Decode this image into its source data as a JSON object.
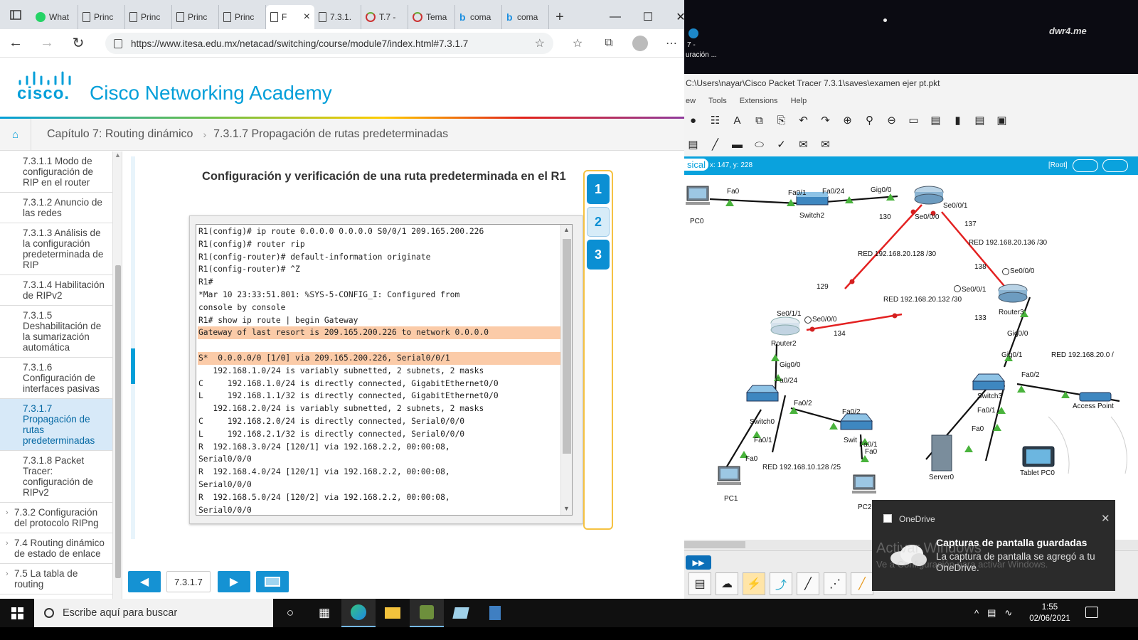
{
  "browser": {
    "tabs": [
      {
        "label": "What",
        "icon": "whatsapp-icon"
      },
      {
        "label": "Princ",
        "icon": "page-icon"
      },
      {
        "label": "Princ",
        "icon": "page-icon"
      },
      {
        "label": "Princ",
        "icon": "page-icon"
      },
      {
        "label": "Princ",
        "icon": "page-icon"
      },
      {
        "label": "F",
        "icon": "page-icon",
        "active": true
      },
      {
        "label": "7.3.1.",
        "icon": "page-icon"
      },
      {
        "label": "T.7 -",
        "icon": "site-icon"
      },
      {
        "label": "Tema",
        "icon": "site-icon"
      },
      {
        "label": "coma",
        "icon": "bing-icon"
      },
      {
        "label": "coma",
        "icon": "bing-icon"
      }
    ],
    "url": "https://www.itesa.edu.mx/netacad/switching/course/module7/index.html#7.3.1.7"
  },
  "header": {
    "logo_text": "cisco.",
    "academy_title": "Cisco Networking Academy",
    "chapter": "Capítulo 7: Routing dinámico",
    "page": "7.3.1.7 Propagación de rutas predeterminadas"
  },
  "sidebar": {
    "items": [
      {
        "label": "7.3.1.1 Modo de configuración de RIP en el router"
      },
      {
        "label": "7.3.1.2 Anuncio de las redes"
      },
      {
        "label": "7.3.1.3 Análisis de la configuración predeterminada de RIP"
      },
      {
        "label": "7.3.1.4 Habilitación de RIPv2"
      },
      {
        "label": "7.3.1.5 Deshabilitación de la sumarización automática"
      },
      {
        "label": "7.3.1.6 Configuración de interfaces pasivas"
      },
      {
        "label": "7.3.1.7 Propagación de rutas predeterminadas",
        "active": true
      },
      {
        "label": "7.3.1.8 Packet Tracer: configuración de RIPv2"
      }
    ],
    "sections": [
      {
        "label": "7.3.2 Configuración del protocolo RIPng"
      },
      {
        "label": "7.4 Routing dinámico de estado de enlace"
      },
      {
        "label": "7.5 La tabla de routing"
      },
      {
        "label": "7.6 Resumen"
      }
    ]
  },
  "content": {
    "title": "Configuración y verificación de una ruta predeterminada en el R1",
    "terminal_lines": [
      {
        "text": "R1(config)# ip route 0.0.0.0 0.0.0.0 S0/0/1 209.165.200.226",
        "hl": false
      },
      {
        "text": "R1(config)# router rip",
        "hl": false
      },
      {
        "text": "R1(config-router)# default-information originate",
        "hl": false
      },
      {
        "text": "R1(config-router)# ^Z",
        "hl": false
      },
      {
        "text": "R1#",
        "hl": false
      },
      {
        "text": "*Mar 10 23:33:51.801: %SYS-5-CONFIG_I: Configured from",
        "hl": false
      },
      {
        "text": "console by console",
        "hl": false
      },
      {
        "text": "R1# show ip route | begin Gateway",
        "hl": false
      },
      {
        "text": "Gateway of last resort is 209.165.200.226 to network 0.0.0.0",
        "hl": true
      },
      {
        "text": "",
        "hl": false
      },
      {
        "text": "S*  0.0.0.0/0 [1/0] via 209.165.200.226, Serial0/0/1",
        "hl": true
      },
      {
        "text": "   192.168.1.0/24 is variably subnetted, 2 subnets, 2 masks",
        "hl": false
      },
      {
        "text": "C     192.168.1.0/24 is directly connected, GigabitEthernet0/0",
        "hl": false
      },
      {
        "text": "L     192.168.1.1/32 is directly connected, GigabitEthernet0/0",
        "hl": false
      },
      {
        "text": "   192.168.2.0/24 is variably subnetted, 2 subnets, 2 masks",
        "hl": false
      },
      {
        "text": "C     192.168.2.0/24 is directly connected, Serial0/0/0",
        "hl": false
      },
      {
        "text": "L     192.168.2.1/32 is directly connected, Serial0/0/0",
        "hl": false
      },
      {
        "text": "R  192.168.3.0/24 [120/1] via 192.168.2.2, 00:00:08,",
        "hl": false
      },
      {
        "text": "Serial0/0/0",
        "hl": false
      },
      {
        "text": "R  192.168.4.0/24 [120/1] via 192.168.2.2, 00:00:08,",
        "hl": false
      },
      {
        "text": "Serial0/0/0",
        "hl": false
      },
      {
        "text": "R  192.168.5.0/24 [120/2] via 192.168.2.2, 00:00:08,",
        "hl": false
      },
      {
        "text": "Serial0/0/0",
        "hl": false
      }
    ],
    "steps": [
      "1",
      "2",
      "3"
    ],
    "page_number": "7.3.1.7"
  },
  "packet_tracer": {
    "desktop_icon_text_1": "7 -",
    "desktop_icon_text_2": "uración ...",
    "desktop_logo": "dwr4.me",
    "title": "C:\\Users\\nayar\\Cisco Packet Tracer 7.3.1\\saves\\examen ejer pt.pkt",
    "menu": [
      "ew",
      "Tools",
      "Extensions",
      "Help"
    ],
    "mode": "sical",
    "coords": "x: 147, y: 228",
    "root": "[Root]",
    "labels": {
      "pc0": "PC0",
      "pc1": "PC1",
      "pc2": "PC2",
      "switch2": "Switch2",
      "switch0": "Switch0",
      "switch1": "Swit",
      "switch3": "Switch3",
      "router2": "Router2",
      "router3": "Router3",
      "server0": "Server0",
      "tablet": "Tablet PC0",
      "ap": "Access Point",
      "fa0_pc0": "Fa0",
      "fa01_s2": "Fa0/1",
      "fa024_s2": "Fa0/24",
      "gig00_r1": "Gig0/0",
      "se001_r1": "Se0/0/1",
      "se000_r1": "Se0/0/0",
      "n130": "130",
      "n137": "137",
      "n138": "138",
      "n129": "129",
      "n134": "134",
      "n133": "133",
      "net128": "RED 192.168.20.128 /30",
      "net136": "RED 192.168.20.136 /30",
      "net132": "RED 192.168.20.132 /30",
      "net_r3": "RED 192.168.20.0 /",
      "net10": "RED 192.168.10.128 /25",
      "se000_r3": "Se0/0/0",
      "se001_r3": "Se0/0/1",
      "se011_r2": "Se0/1/1",
      "se000_r2": "Se0/0/0",
      "gig00_r2": "Gig0/0",
      "fa024_s0": "Fa0/24",
      "fa02_s0": "Fa0/2",
      "fa02_s1": "Fa0/2",
      "fa01_s0": "Fa0/1",
      "fa0_pc1": "Fa0",
      "fa01_s1": "Fa0/1",
      "fa0_pc2": "Fa0",
      "gig00_r3": "Gig0/0",
      "gig01_s3": "Gig0/1",
      "fa02_s3": "Fa0/2",
      "fa01_s3": "Fa0/1",
      "fa0_srv": "Fa0"
    }
  },
  "toast": {
    "app": "OneDrive",
    "heading": "Capturas de pantalla guardadas",
    "body": "La captura de pantalla se agregó a tu OneDrive.",
    "watermark_1": "Activar Windows",
    "watermark_2": "Ve a Configuración para activar Windows."
  },
  "taskbar": {
    "search_placeholder": "Escribe aquí para buscar",
    "time": "1:55",
    "date": "02/06/2021"
  }
}
